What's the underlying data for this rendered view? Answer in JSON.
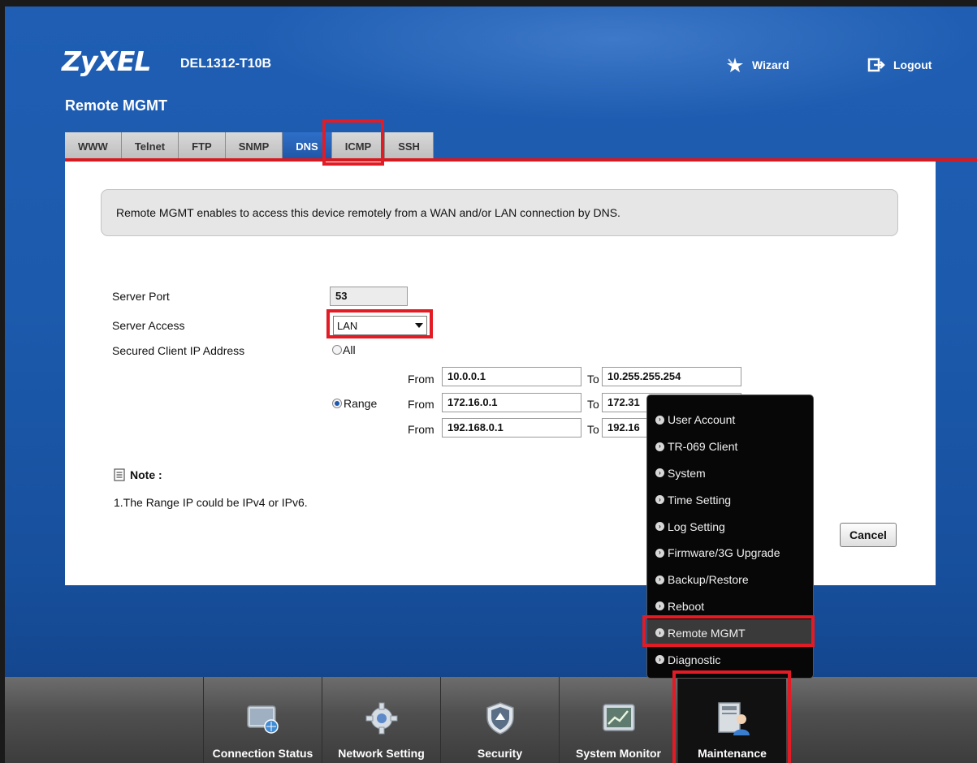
{
  "header": {
    "brand": "ZyXEL",
    "model": "DEL1312-T10B",
    "page_title": "Remote MGMT",
    "wizard_label": "Wizard",
    "logout_label": "Logout"
  },
  "tabs": [
    {
      "label": "WWW"
    },
    {
      "label": "Telnet"
    },
    {
      "label": "FTP"
    },
    {
      "label": "SNMP"
    },
    {
      "label": "DNS",
      "active": true
    },
    {
      "label": "ICMP"
    },
    {
      "label": "SSH"
    }
  ],
  "info_text": "Remote MGMT enables to access this device remotely from a WAN and/or LAN connection by DNS.",
  "form": {
    "server_port_label": "Server Port",
    "server_port_value": "53",
    "server_access_label": "Server Access",
    "server_access_value": "LAN",
    "secured_ip_label": "Secured Client IP Address",
    "all_label": "All",
    "range_label": "Range",
    "from_label": "From",
    "to_label": "To",
    "ranges": [
      {
        "from": "10.0.0.1",
        "to": "10.255.255.254"
      },
      {
        "from": "172.16.0.1",
        "to": "172.31"
      },
      {
        "from": "192.168.0.1",
        "to": "192.16"
      }
    ],
    "selected_option": "Range"
  },
  "note": {
    "title": "Note :",
    "text": "1.The Range IP could be IPv4 or IPv6."
  },
  "cancel_label": "Cancel",
  "maintenance_menu": [
    {
      "label": "User Account"
    },
    {
      "label": "TR-069 Client"
    },
    {
      "label": "System"
    },
    {
      "label": "Time Setting"
    },
    {
      "label": "Log Setting"
    },
    {
      "label": "Firmware/3G Upgrade"
    },
    {
      "label": "Backup/Restore"
    },
    {
      "label": "Reboot"
    },
    {
      "label": "Remote MGMT",
      "active": true
    },
    {
      "label": "Diagnostic"
    }
  ],
  "bottom_nav": [
    {
      "label": "Connection Status",
      "icon": "connection-status-icon"
    },
    {
      "label": "Network Setting",
      "icon": "gear-icon"
    },
    {
      "label": "Security",
      "icon": "shield-icon"
    },
    {
      "label": "System Monitor",
      "icon": "monitor-chart-icon"
    },
    {
      "label": "Maintenance",
      "icon": "maintenance-icon",
      "active": true
    }
  ],
  "colors": {
    "background_blue": "#1c5aad",
    "tab_active": "#2f6fc8",
    "highlight_red": "#e21b24",
    "bottom_bar": "#4f4f4f",
    "menu_bg": "#070707"
  }
}
